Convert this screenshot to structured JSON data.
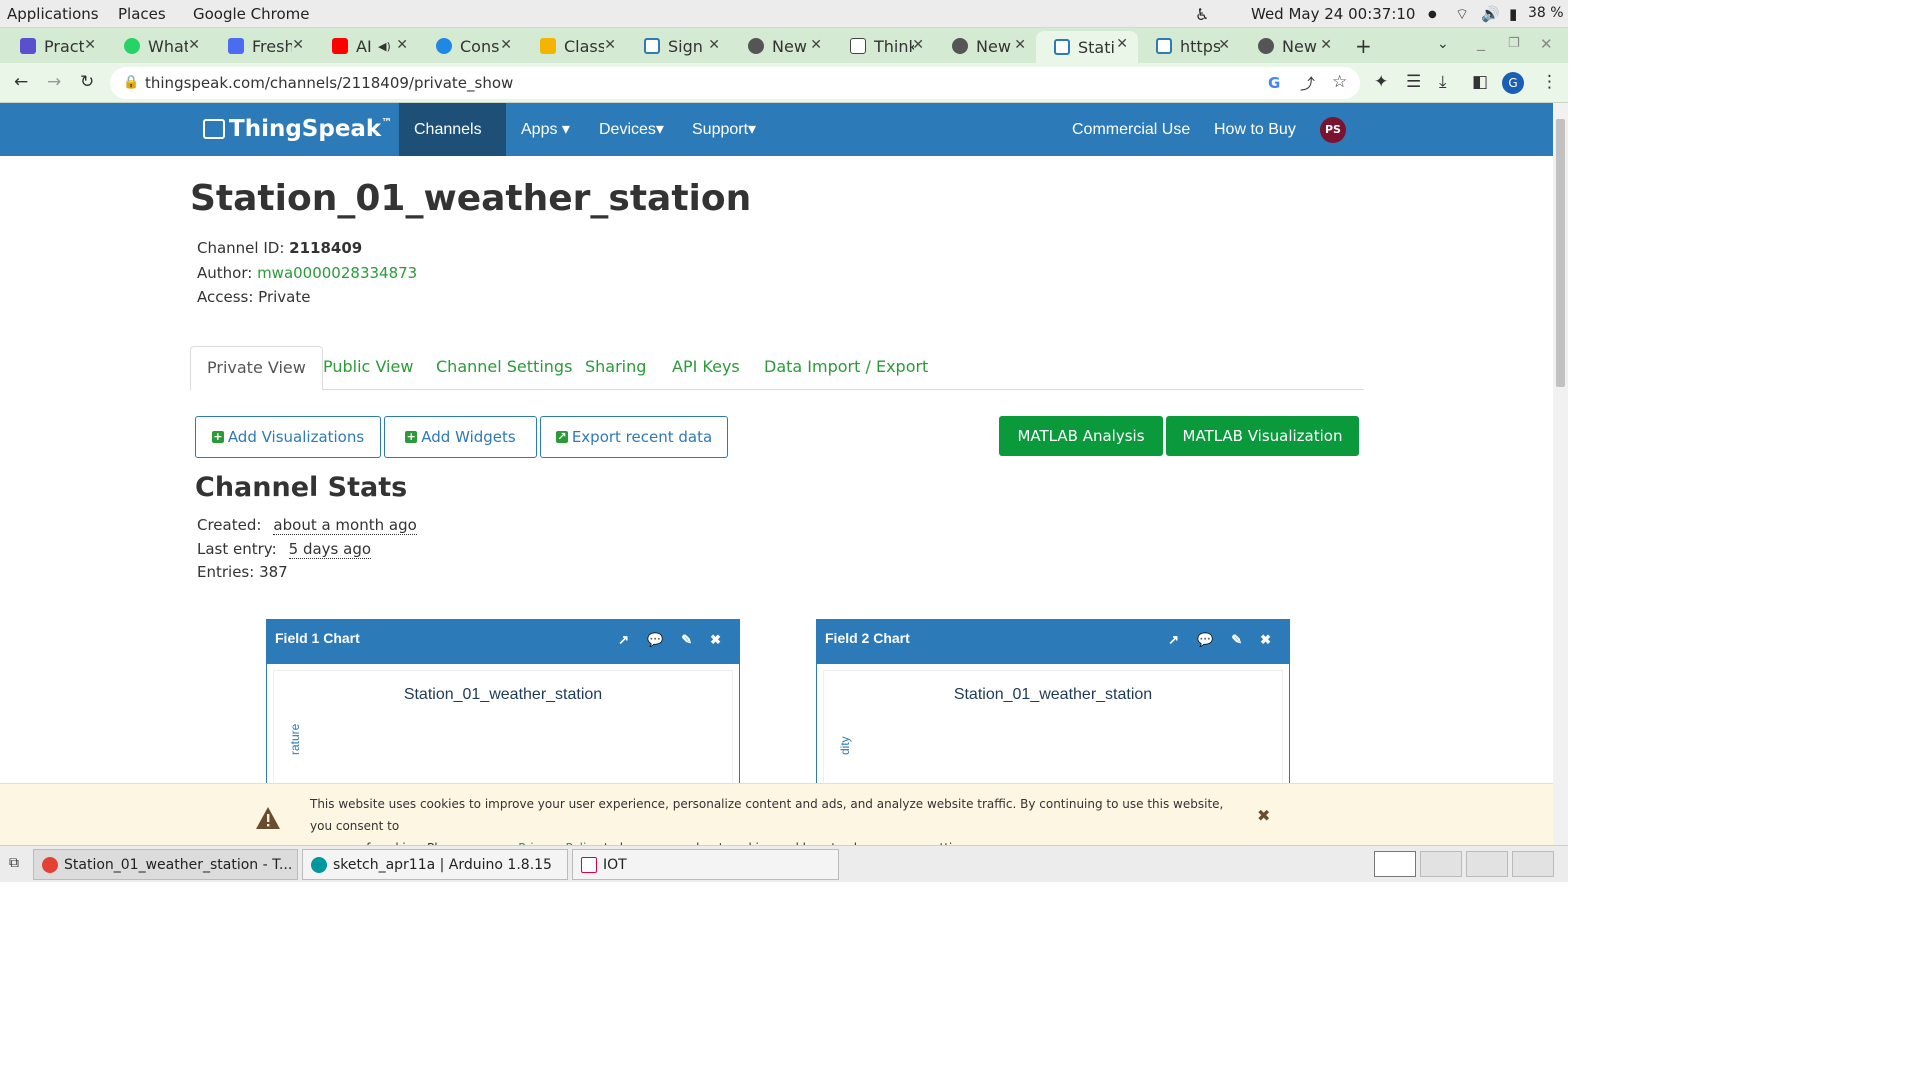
{
  "os": {
    "menus": [
      "Applications",
      "Places",
      "Google Chrome"
    ],
    "datetime": "Wed May 24  00:37:10",
    "battery": "38 %"
  },
  "tabs": [
    {
      "title": "Pract",
      "icon_color": "#5a4fcf",
      "icon": "list-icon"
    },
    {
      "title": "What",
      "icon_color": "#25d366",
      "icon": "whatsapp-icon"
    },
    {
      "title": "Fresh",
      "icon_color": "#4b6cf0",
      "icon": "fresh-icon"
    },
    {
      "title": "AI",
      "icon_color": "#ff0000",
      "icon": "youtube-icon"
    },
    {
      "title": "Cons",
      "icon_color": "#1e88e5",
      "icon": "globe-icon"
    },
    {
      "title": "Class",
      "icon_color": "#f4b400",
      "icon": "classroom-icon"
    },
    {
      "title": "Sign",
      "icon_color": "#2d7ab8",
      "icon": "thingspeak-icon"
    },
    {
      "title": "New",
      "icon_color": "#555555",
      "icon": "chrome-icon"
    },
    {
      "title": "Think",
      "icon_color": "#444444",
      "icon": "chart-icon"
    },
    {
      "title": "New",
      "icon_color": "#555555",
      "icon": "chrome-icon"
    },
    {
      "title": "Stati",
      "icon_color": "#2d7ab8",
      "icon": "thingspeak-icon"
    },
    {
      "title": "https",
      "icon_color": "#2d7ab8",
      "icon": "thingspeak-icon"
    },
    {
      "title": "New",
      "icon_color": "#555555",
      "icon": "chrome-icon"
    }
  ],
  "address": {
    "url": "thingspeak.com/channels/2118409/private_show"
  },
  "nav": {
    "logo": "ThingSpeak",
    "logo_tm": "™",
    "channels": "Channels ▾",
    "apps": "Apps ▾",
    "devices": "Devices▾",
    "support": "Support▾",
    "commercial": "Commercial Use",
    "how_to_buy": "How to Buy",
    "avatar": "PS"
  },
  "channel": {
    "title": "Station_01_weather_station",
    "id_label": "Channel ID: ",
    "id": "2118409",
    "author_label": "Author: ",
    "author": "mwa0000028334873",
    "access": "Access: Private"
  },
  "channel_tabs": {
    "private_view": "Private View",
    "public_view": "Public View",
    "settings": "Channel Settings",
    "sharing": "Sharing",
    "api_keys": "API Keys",
    "import_export": "Data Import / Export"
  },
  "buttons": {
    "add_viz": "Add Visualizations",
    "add_widgets": "Add Widgets",
    "export": "Export recent data",
    "matlab_analysis": "MATLAB Analysis",
    "matlab_viz": "MATLAB Visualization"
  },
  "stats": {
    "title": "Channel Stats",
    "created_label": "Created:",
    "created": "about a month ago",
    "last_label": "Last entry:",
    "last": "5 days ago",
    "entries": "Entries: 387"
  },
  "charts": [
    {
      "header": "Field 1 Chart",
      "title": "Station_01_weather_station",
      "ylabel": "rature"
    },
    {
      "header": "Field 2 Chart",
      "title": "Station_01_weather_station",
      "ylabel": "dity"
    }
  ],
  "cookie": {
    "text1": "This website uses cookies to improve your user experience, personalize content and ads, and analyze website traffic. By continuing to use this website, you consent to",
    "text2a": "our use of cookies. Please see our ",
    "link": "Privacy Policy",
    "text2b": " to learn more about cookies and how to change your settings."
  },
  "taskbar": {
    "task1": "Station_01_weather_station - T...",
    "task2": "sketch_apr11a | Arduino 1.8.15",
    "task3": "IOT"
  }
}
